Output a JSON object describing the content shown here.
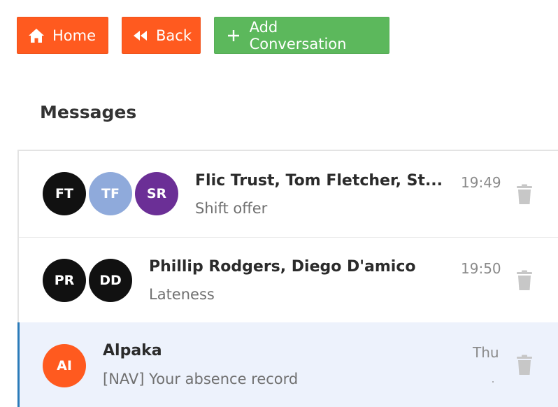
{
  "toolbar": {
    "home_label": "Home",
    "back_label": "Back",
    "add_label": "Add Conversation",
    "colors": {
      "primary": "#ff5a1f",
      "success": "#5cb85c"
    }
  },
  "page": {
    "title": "Messages"
  },
  "conversations": [
    {
      "title": "Flic Trust, Tom Fletcher, St...",
      "subtitle": "Shift offer",
      "time": "19:49",
      "avatars": [
        {
          "initials": "FT",
          "color": "#111111"
        },
        {
          "initials": "TF",
          "color": "#8faadb"
        },
        {
          "initials": "SR",
          "color": "#6b2f96"
        }
      ]
    },
    {
      "title": "Phillip Rodgers, Diego D'amico",
      "subtitle": "Lateness",
      "time": "19:50",
      "avatars": [
        {
          "initials": "PR",
          "color": "#111111"
        },
        {
          "initials": "DD",
          "color": "#111111"
        }
      ]
    },
    {
      "title": "Alpaka",
      "subtitle": "[NAV]  Your absence record",
      "time": "Thu",
      "selected": true,
      "avatars": [
        {
          "initials": "AI",
          "color": "#ff5a1f"
        }
      ]
    }
  ],
  "icons": {
    "home": "home-icon",
    "back": "backward-icon",
    "add": "plus-icon",
    "delete": "trash-icon"
  }
}
